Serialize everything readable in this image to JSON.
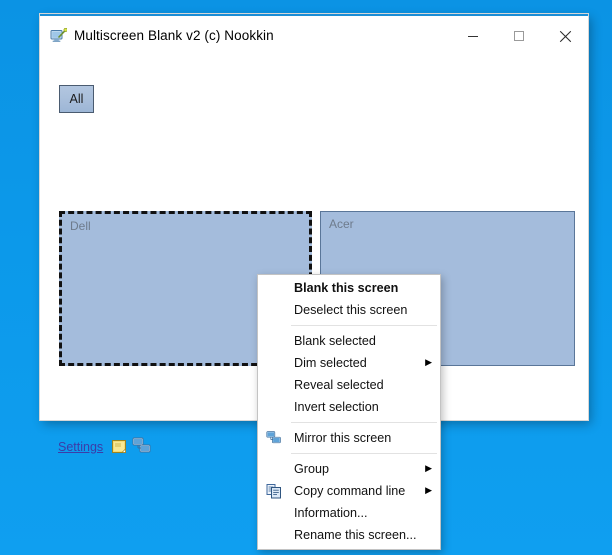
{
  "desktop": {
    "background_color": "#0c97e8"
  },
  "window": {
    "title": "Multiscreen Blank v2 (c) Nookkin",
    "icon": "monitor-wand-icon",
    "accent_color": "#1b8ed6",
    "controls": {
      "minimize": "minimize-icon",
      "maximize": "maximize-icon",
      "close": "close-icon"
    }
  },
  "toolbar": {
    "all_label": "All"
  },
  "monitors": [
    {
      "label": "Dell",
      "selected": true,
      "fill_color": "#a4bcdc"
    },
    {
      "label": "Acer",
      "selected": false,
      "fill_color": "#a4bcdc"
    }
  ],
  "footer": {
    "settings_label": "Settings",
    "note_icon": "note-icon",
    "network_icon": "network-computer-icon"
  },
  "context_menu": {
    "groups": [
      {
        "items": [
          {
            "label": "Blank this screen",
            "bold": true,
            "icon": null,
            "submenu": false
          },
          {
            "label": "Deselect this screen",
            "bold": false,
            "icon": null,
            "submenu": false
          }
        ]
      },
      {
        "items": [
          {
            "label": "Blank selected",
            "bold": false,
            "icon": null,
            "submenu": false
          },
          {
            "label": "Dim selected",
            "bold": false,
            "icon": null,
            "submenu": true
          },
          {
            "label": "Reveal selected",
            "bold": false,
            "icon": null,
            "submenu": false
          },
          {
            "label": "Invert selection",
            "bold": false,
            "icon": null,
            "submenu": false
          }
        ]
      },
      {
        "items": [
          {
            "label": "Mirror this screen",
            "bold": false,
            "icon": "network-computer-icon",
            "submenu": false
          }
        ]
      },
      {
        "items": [
          {
            "label": "Group",
            "bold": false,
            "icon": null,
            "submenu": true
          },
          {
            "label": "Copy command line",
            "bold": false,
            "icon": "copy-icon",
            "submenu": true
          },
          {
            "label": "Information...",
            "bold": false,
            "icon": null,
            "submenu": false
          },
          {
            "label": "Rename this screen...",
            "bold": false,
            "icon": null,
            "submenu": false
          }
        ]
      }
    ],
    "submenu_arrow_glyph": "▶"
  }
}
